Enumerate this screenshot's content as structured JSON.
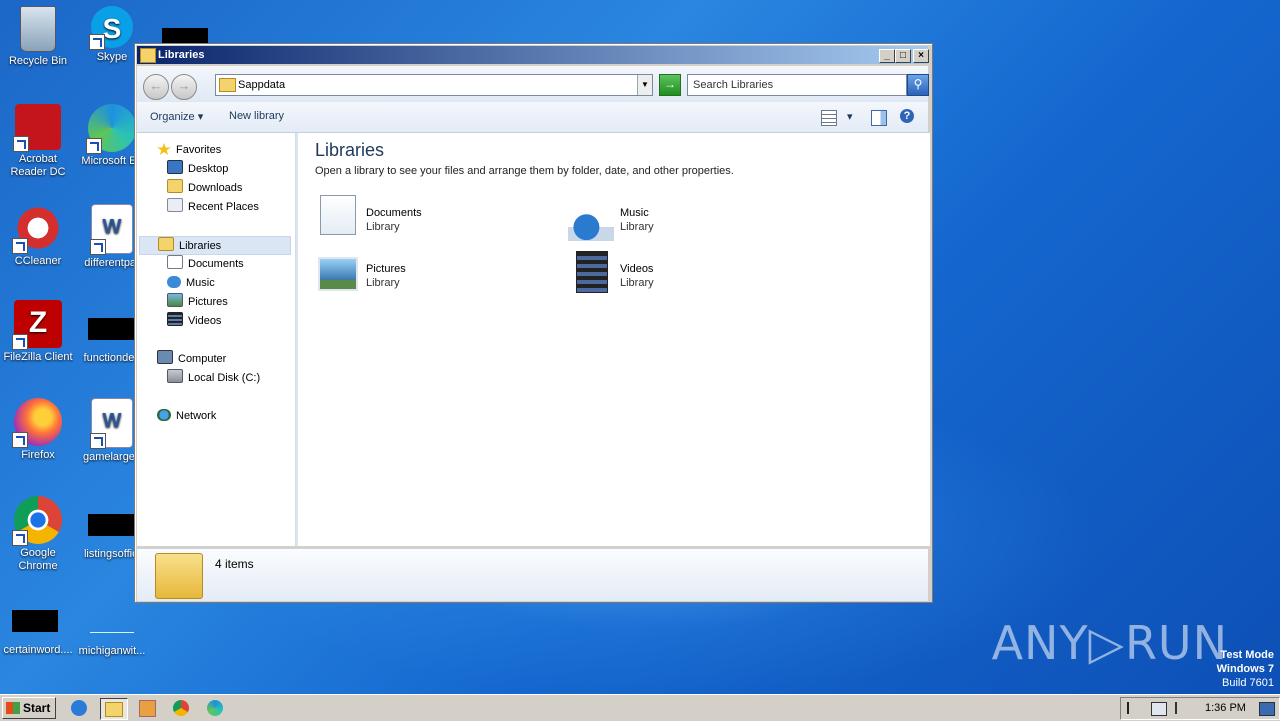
{
  "desktop": {
    "icons": [
      {
        "label": "Recycle Bin",
        "icon": "recycle-bin-icon"
      },
      {
        "label": "Skype",
        "icon": "skype-icon"
      },
      {
        "label": "Acrobat Reader DC",
        "icon": "acrobat-icon"
      },
      {
        "label": "Microsoft Ed",
        "icon": "edge-icon"
      },
      {
        "label": "CCleaner",
        "icon": "ccleaner-icon"
      },
      {
        "label": "differentpar",
        "icon": "word-doc-icon"
      },
      {
        "label": "FileZilla Client",
        "icon": "filezilla-icon"
      },
      {
        "label": "functiondea",
        "icon": "redacted-icon"
      },
      {
        "label": "Firefox",
        "icon": "firefox-icon"
      },
      {
        "label": "gamelarger.",
        "icon": "word-doc-icon"
      },
      {
        "label": "Google Chrome",
        "icon": "chrome-icon"
      },
      {
        "label": "listingsoffici",
        "icon": "redacted-icon"
      },
      {
        "label": "certainword....",
        "icon": "redacted-icon"
      },
      {
        "label": "michiganwit...",
        "icon": "blank-file-icon"
      }
    ]
  },
  "window": {
    "title": "Libraries",
    "address": "Sappdata",
    "search_placeholder": "Search Libraries",
    "commands": {
      "organize": "Organize",
      "new_library": "New library"
    },
    "nav": {
      "favorites": "Favorites",
      "desktop": "Desktop",
      "downloads": "Downloads",
      "recent": "Recent Places",
      "libraries": "Libraries",
      "documents": "Documents",
      "music": "Music",
      "pictures": "Pictures",
      "videos": "Videos",
      "computer": "Computer",
      "local_disk": "Local Disk (C:)",
      "network": "Network"
    },
    "content": {
      "title": "Libraries",
      "subtitle": "Open a library to see your files and arrange them by folder, date, and other properties.",
      "libraries": [
        {
          "name": "Documents",
          "type": "Library"
        },
        {
          "name": "Music",
          "type": "Library"
        },
        {
          "name": "Pictures",
          "type": "Library"
        },
        {
          "name": "Videos",
          "type": "Library"
        }
      ]
    },
    "details": {
      "count": "4 items"
    }
  },
  "watermark": {
    "brand": "ANY▷RUN",
    "line1": "Test Mode",
    "line2": "Windows 7",
    "line3": "Build 7601"
  },
  "taskbar": {
    "start": "Start",
    "clock": "1:36 PM"
  }
}
